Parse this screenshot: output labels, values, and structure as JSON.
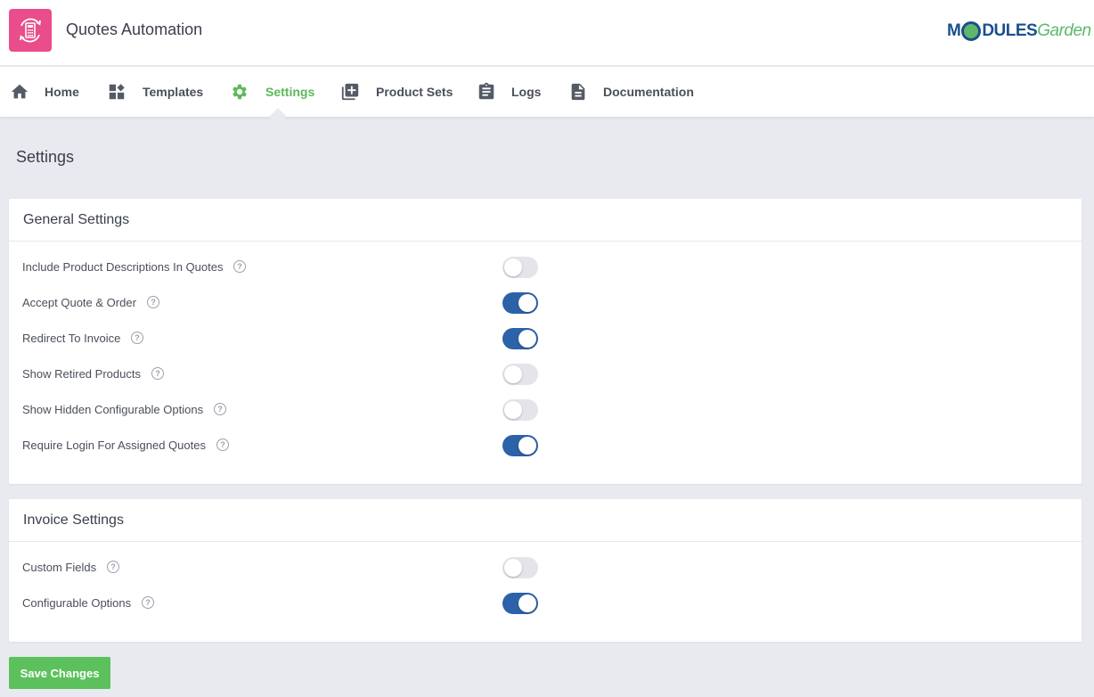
{
  "app": {
    "title": "Quotes Automation",
    "icon": "calculator-refresh-icon",
    "accent": "#e94d8b"
  },
  "brand": {
    "part1": "M",
    "part2": "DULES",
    "part3": "Garden"
  },
  "nav": {
    "items": [
      {
        "label": "Home",
        "icon": "home-icon"
      },
      {
        "label": "Templates",
        "icon": "templates-icon"
      },
      {
        "label": "Settings",
        "icon": "gear-icon",
        "active": true
      },
      {
        "label": "Product Sets",
        "icon": "add-library-icon"
      },
      {
        "label": "Logs",
        "icon": "clipboard-icon"
      },
      {
        "label": "Documentation",
        "icon": "document-icon"
      }
    ],
    "active_color": "#5cb85c"
  },
  "page": {
    "title": "Settings"
  },
  "general": {
    "title": "General Settings",
    "rows": [
      {
        "label": "Include Product Descriptions In Quotes",
        "enabled": false
      },
      {
        "label": "Accept Quote & Order",
        "enabled": true
      },
      {
        "label": "Redirect To Invoice",
        "enabled": true
      },
      {
        "label": "Show Retired Products",
        "enabled": false
      },
      {
        "label": "Show Hidden Configurable Options",
        "enabled": false
      },
      {
        "label": "Require Login For Assigned Quotes",
        "enabled": true
      }
    ]
  },
  "invoice": {
    "title": "Invoice Settings",
    "rows": [
      {
        "label": "Custom Fields",
        "enabled": false
      },
      {
        "label": "Configurable Options",
        "enabled": true
      }
    ]
  },
  "actions": {
    "save_label": "Save Changes",
    "save_color": "#5cc15c"
  },
  "toggle_on_color": "#2c62a8"
}
